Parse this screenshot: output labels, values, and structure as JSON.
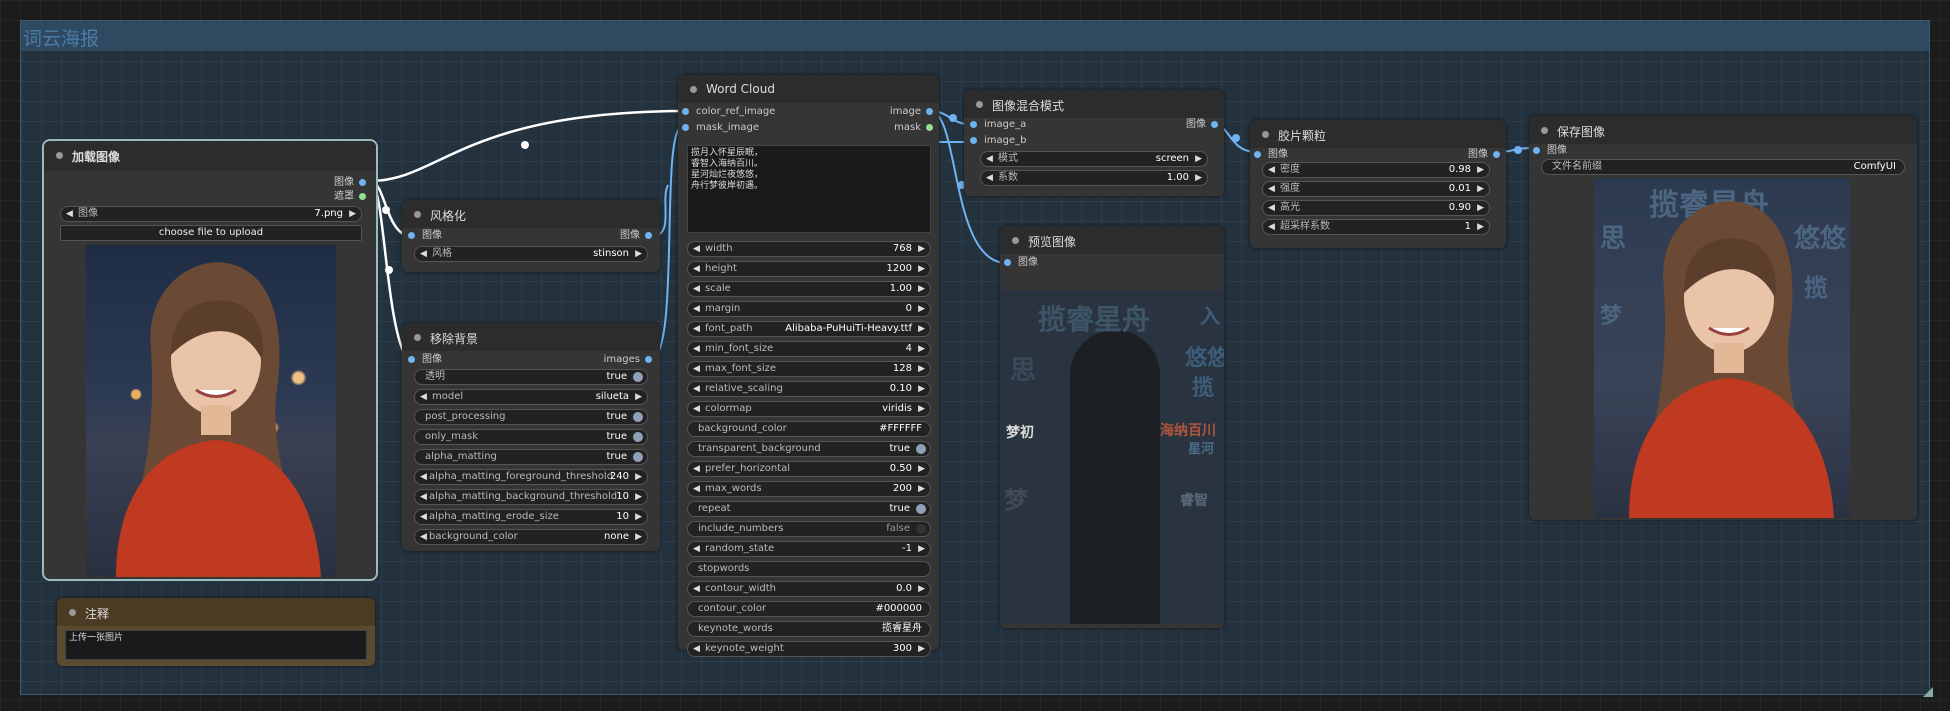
{
  "group": {
    "title": "词云海报"
  },
  "load_image": {
    "title": "加载图像",
    "out_image": "图像",
    "out_mask": "遮罩",
    "image_label": "图像",
    "image_value": "7.png",
    "upload_label": "choose file to upload"
  },
  "note": {
    "title": "注释",
    "text": "上传一张图片"
  },
  "stylize": {
    "title": "风格化",
    "in_image": "图像",
    "out_image": "图像",
    "style_label": "风格",
    "style_value": "stinson"
  },
  "remove_bg": {
    "title": "移除背景",
    "in_image": "图像",
    "out_images": "images",
    "widgets": [
      {
        "label": "透明",
        "value": "true"
      },
      {
        "label": "model",
        "value": "silueta"
      },
      {
        "label": "post_processing",
        "value": "true"
      },
      {
        "label": "only_mask",
        "value": "true"
      },
      {
        "label": "alpha_matting",
        "value": "true"
      },
      {
        "label": "alpha_matting_foreground_threshold",
        "value": "240"
      },
      {
        "label": "alpha_matting_background_threshold",
        "value": "10"
      },
      {
        "label": "alpha_matting_erode_size",
        "value": "10"
      },
      {
        "label": "background_color",
        "value": "none"
      }
    ]
  },
  "word_cloud": {
    "title": "Word Cloud",
    "in_color_ref": "color_ref_image",
    "in_mask": "mask_image",
    "out_image": "image",
    "out_mask": "mask",
    "text": "揽月入怀星辰眠，\n睿智入海纳百川。\n星河灿烂夜悠悠，\n舟行梦彼岸初遇。",
    "widgets": [
      {
        "label": "width",
        "value": "768"
      },
      {
        "label": "height",
        "value": "1200"
      },
      {
        "label": "scale",
        "value": "1.00"
      },
      {
        "label": "margin",
        "value": "0"
      },
      {
        "label": "font_path",
        "value": "Alibaba-PuHuiTi-Heavy.ttf"
      },
      {
        "label": "min_font_size",
        "value": "4"
      },
      {
        "label": "max_font_size",
        "value": "128"
      },
      {
        "label": "relative_scaling",
        "value": "0.10"
      },
      {
        "label": "colormap",
        "value": "viridis"
      },
      {
        "label": "background_color",
        "value": "#FFFFFF"
      },
      {
        "label": "transparent_background",
        "value": "true"
      },
      {
        "label": "prefer_horizontal",
        "value": "0.50"
      },
      {
        "label": "max_words",
        "value": "200"
      },
      {
        "label": "repeat",
        "value": "true"
      },
      {
        "label": "include_numbers",
        "value": "false"
      },
      {
        "label": "random_state",
        "value": "-1"
      },
      {
        "label": "stopwords",
        "value": ""
      },
      {
        "label": "contour_width",
        "value": "0.0"
      },
      {
        "label": "contour_color",
        "value": "#000000"
      },
      {
        "label": "keynote_words",
        "value": "揽睿星舟"
      },
      {
        "label": "keynote_weight",
        "value": "300"
      }
    ]
  },
  "blend": {
    "title": "图像混合模式",
    "in_a": "image_a",
    "in_b": "image_b",
    "out_image": "图像",
    "mode_label": "模式",
    "mode_value": "screen",
    "factor_label": "系数",
    "factor_value": "1.00"
  },
  "preview": {
    "title": "预览图像",
    "in_image": "图像"
  },
  "grain": {
    "title": "胶片颗粒",
    "in_image": "图像",
    "out_image": "图像",
    "widgets": [
      {
        "label": "密度",
        "value": "0.98"
      },
      {
        "label": "强度",
        "value": "0.01"
      },
      {
        "label": "高光",
        "value": "0.90"
      },
      {
        "label": "超采样系数",
        "value": "1"
      }
    ]
  },
  "save": {
    "title": "保存图像",
    "in_image": "图像",
    "prefix_label": "文件名前缀",
    "prefix_value": "ComfyUI"
  },
  "wordcloud_words": {
    "big": "揽睿星舟",
    "w1": "海纳百川",
    "w2": "星河",
    "w3": "梦初",
    "w4": "悠悠",
    "w5": "揽",
    "w6": "入",
    "w7": "思",
    "w8": "梦",
    "w9": "睿智"
  }
}
